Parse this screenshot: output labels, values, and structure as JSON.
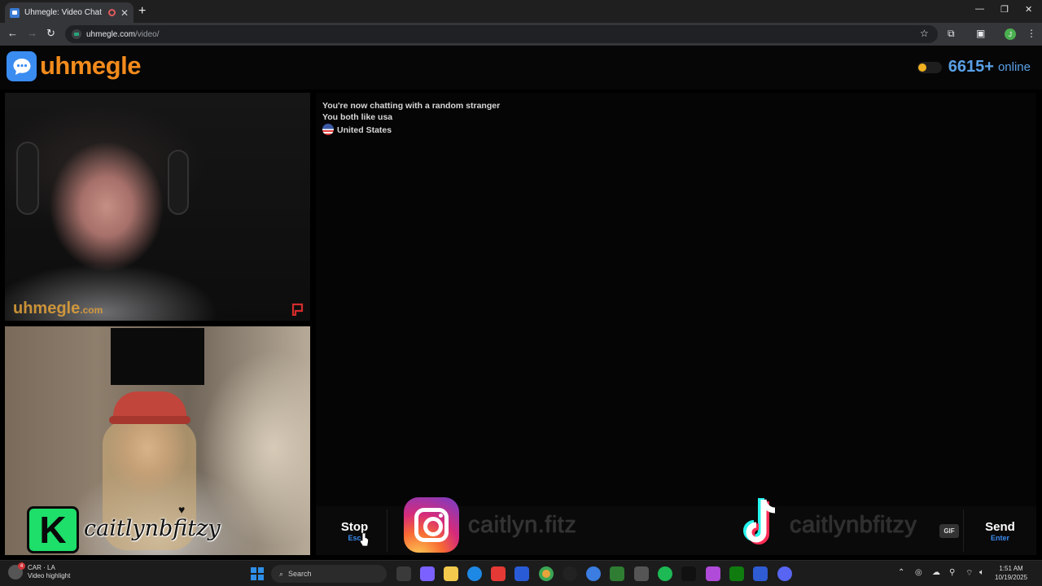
{
  "browser": {
    "tab_title": "Uhmegle: Video Chat | Random Stranger Chat",
    "url_host": "uhmegle.com",
    "url_path": "/video/",
    "profile_initial": "J"
  },
  "site": {
    "logo_text": "uhmegle",
    "online_count": "6615+",
    "online_label": "online"
  },
  "video": {
    "watermark": "uhmegle",
    "watermark_suffix": ".com",
    "badge_letter": "K",
    "self_handle": "caitlynbfitzy"
  },
  "chat": {
    "messages": [
      "You're now chatting with a random stranger",
      "You both like usa",
      "United States"
    ]
  },
  "controls": {
    "stop_label": "Stop",
    "stop_hint": "Esc",
    "instagram_handle": "caitlyn.fitz",
    "tiktok_handle": "caitlynbfitzy",
    "gif_label": "GIF",
    "send_label": "Send",
    "send_hint": "Enter"
  },
  "taskbar": {
    "widget_title": "CAR · LA",
    "widget_subtitle": "Video highlight",
    "widget_badge": "4",
    "search_placeholder": "Search",
    "time": "1:51 AM",
    "date": "10/19/2025"
  },
  "colors": {
    "brand_orange": "#f28b1c",
    "brand_blue": "#3a8cf0",
    "online_blue": "#5aa0e6",
    "k_badge_green": "#1ddf6a"
  }
}
